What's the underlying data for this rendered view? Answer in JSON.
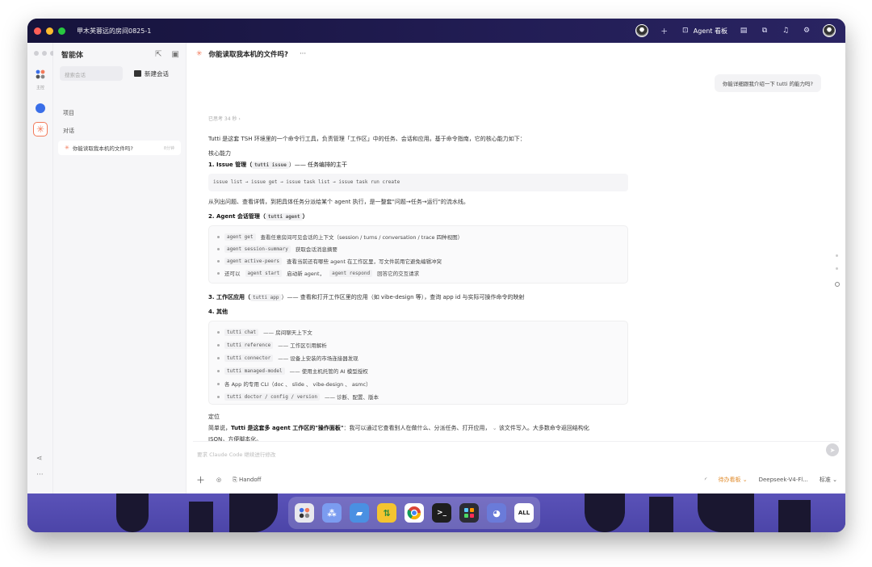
{
  "window": {
    "title": "甲木芙蓉远的房间0825-1",
    "agent_board": "Agent 看板"
  },
  "sidebar": {
    "title": "智能体",
    "search_placeholder": "搜索会话",
    "new_chat": "新建会话",
    "section_projects": "项目",
    "section_conversations": "对话",
    "conversation": {
      "title": "你能读取我本机的文件吗?",
      "time": "8分钟"
    },
    "rail_label": "主控"
  },
  "main": {
    "header_title": "你能读取我本机的文件吗?",
    "header_more": "···",
    "user_message": "你能详细跟我介绍一下 tutti 的能力吗?",
    "thought": "已思考 34 秒 ›",
    "intro": "Tutti 是这套 TSH 环境里的一个命令行工具，负责管理「工作区」中的任务、会话和应用。基于命令指南，它的核心能力如下：",
    "core_label": "核心能力",
    "sec1_title": "1. Issue 管理（",
    "sec1_code": "tutti issue",
    "sec1_tail": "）—— 任务编排的主干",
    "sec1_codeblock": "issue list → issue get → issue task list → issue task run create",
    "sec1_desc": "从列出问题、查看详情，到把具体任务分派给某个 agent 执行，是一整套\"问题→任务→运行\"的流水线。",
    "sec2_title": "2. Agent 会话管理（",
    "sec2_code": "tutti agent",
    "sec2_tail": "）",
    "sec2_items": [
      {
        "code": "agent get",
        "text": "查看任意房间可见会话的上下文（session / turns / conversation / trace 四种视图）"
      },
      {
        "code": "agent session-summary",
        "text": "获取会话消息摘要"
      },
      {
        "code": "agent active-peers",
        "text": "查看当前还有哪些 agent 在工作区里，写文件前用它避免编辑冲突"
      },
      {
        "code": "agent start",
        "text": "还可以",
        "code2": "agent respond",
        "text2": "启动新 agent，",
        "text3": "回答它的交互请求"
      }
    ],
    "sec3_title": "3. 工作区应用（",
    "sec3_code": "tutti app",
    "sec3_tail": "）—— 查看和打开工作区里的应用（如 vibe-design 等），查询 app id 与实际可操作命令的映射",
    "sec4_title": "4. 其他",
    "sec4_items": [
      {
        "code": "tutti chat",
        "text": "—— 房间聊天上下文"
      },
      {
        "code": "tutti reference",
        "text": "—— 工作区引用解析"
      },
      {
        "code": "tutti connector",
        "text": "—— 设备上安装的市场连接器发现"
      },
      {
        "code": "tutti managed-model",
        "text": "—— 使用主机托管的 AI 模型授权"
      },
      {
        "code": "",
        "text": "各 App 的专用 CLI（doc 、 slide 、 vibe-design 、 asmc）"
      },
      {
        "code": "tutti doctor / config / version",
        "text": "—— 诊断、配置、版本"
      }
    ],
    "summary_label": "定位",
    "summary_prefix": "简单说，",
    "summary_bold": "Tutti 是这套多 agent 工作区的\"操作面板\"",
    "summary_rest": "：我可以通过它查看别人在做什么、分派任务、打开应用，",
    "summary_rest2": "该文件写入。大多数命令返回结构化",
    "summary_line2": "JSON，方便脚本化。",
    "input_placeholder": "要求 Claude Code 继续进行修改",
    "handoff": "Handoff",
    "status_orange": "待办看板",
    "model": "Deepseek-V4-Fl...",
    "mode": "标准"
  },
  "dock": {
    "items": [
      "app-tutti",
      "app-agents",
      "finder",
      "transfer",
      "chrome",
      "terminal",
      "launchpad",
      "messages",
      "ALL"
    ],
    "all_label": "ALL"
  },
  "colors": {
    "accent": "#f27a5a",
    "titlebar": "#1f1b4a",
    "wallpaper": "#5a52b8"
  }
}
